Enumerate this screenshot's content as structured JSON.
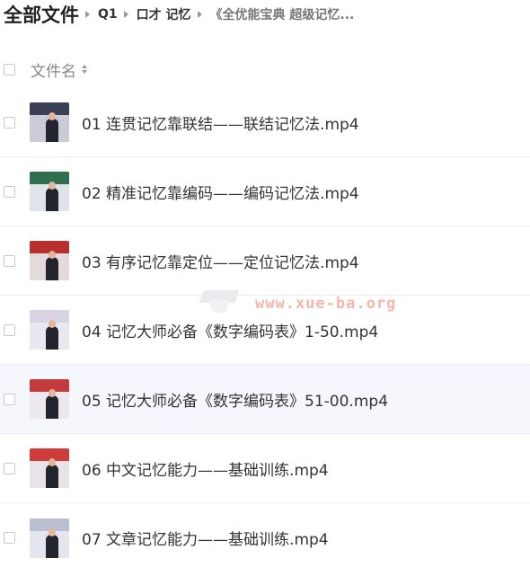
{
  "breadcrumb": {
    "root": "全部文件",
    "items": [
      "Q1",
      "口才 记忆",
      "《全优能宝典 超级记忆..."
    ]
  },
  "list": {
    "header_label": "文件名",
    "files": [
      {
        "name": "01 连贯记忆靠联结——联结记忆法.mp4",
        "thumb": {
          "bg": "#c9cbd8",
          "band": "#3a3f55"
        }
      },
      {
        "name": "02 精准记忆靠编码——编码记忆法.mp4",
        "thumb": {
          "bg": "#dfe4ea",
          "band": "#2f6f4e"
        }
      },
      {
        "name": "03 有序记忆靠定位——定位记忆法.mp4",
        "thumb": {
          "bg": "#e4dada",
          "band": "#b8302d"
        }
      },
      {
        "name": "04 记忆大师必备《数字编码表》1-50.mp4",
        "thumb": {
          "bg": "#e9e7ef",
          "band": "#d9d4e3"
        }
      },
      {
        "name": "05 记忆大师必备《数字编码表》51-00.mp4",
        "thumb": {
          "bg": "#ece8ee",
          "band": "#c33b3b"
        }
      },
      {
        "name": "06 中文记忆能力——基础训练.mp4",
        "thumb": {
          "bg": "#e7e3e8",
          "band": "#cf3a3a"
        }
      },
      {
        "name": "07 文章记忆能力——基础训练.mp4",
        "thumb": {
          "bg": "#e3e6ee",
          "band": "#b9bfd0"
        }
      }
    ]
  },
  "watermark": {
    "text": "www.xue-ba.org"
  }
}
